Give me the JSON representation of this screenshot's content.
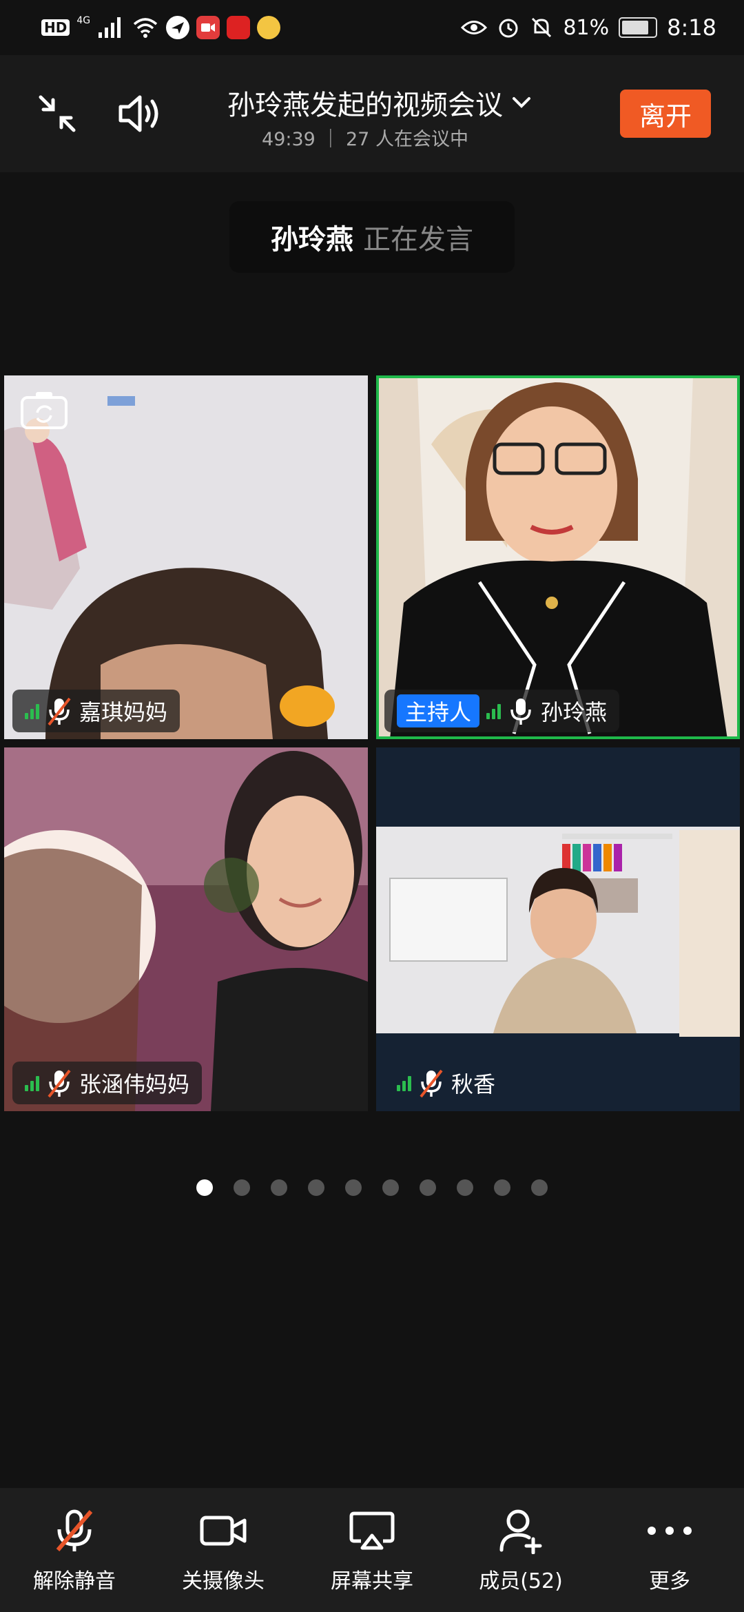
{
  "status_bar": {
    "hd": "HD",
    "network": "4G",
    "battery": "81%",
    "time": "8:18"
  },
  "header": {
    "title": "孙玲燕发起的视频会议",
    "subtitle": "49:39 ｜ 27 人在会议中",
    "leave_label": "离开"
  },
  "speaking": {
    "name": "孙玲燕",
    "state": "正在发言"
  },
  "tiles": [
    {
      "name": "嘉琪妈妈",
      "muted": true
    },
    {
      "name": "孙玲燕",
      "host_badge": "主持人",
      "muted": false,
      "active_speaker": true
    },
    {
      "name": "张涵伟妈妈",
      "muted": true
    },
    {
      "name": "秋香",
      "muted": true
    }
  ],
  "pagination": {
    "total": 10,
    "current": 1
  },
  "toolbar": {
    "unmute": "解除静音",
    "camera": "关摄像头",
    "share": "屏幕共享",
    "members": "成员(52)",
    "more": "更多"
  },
  "colors": {
    "leave": "#f05a24",
    "host_badge": "#1677ff",
    "signal": "#2bbd4f",
    "active_border": "#1fb84a"
  }
}
